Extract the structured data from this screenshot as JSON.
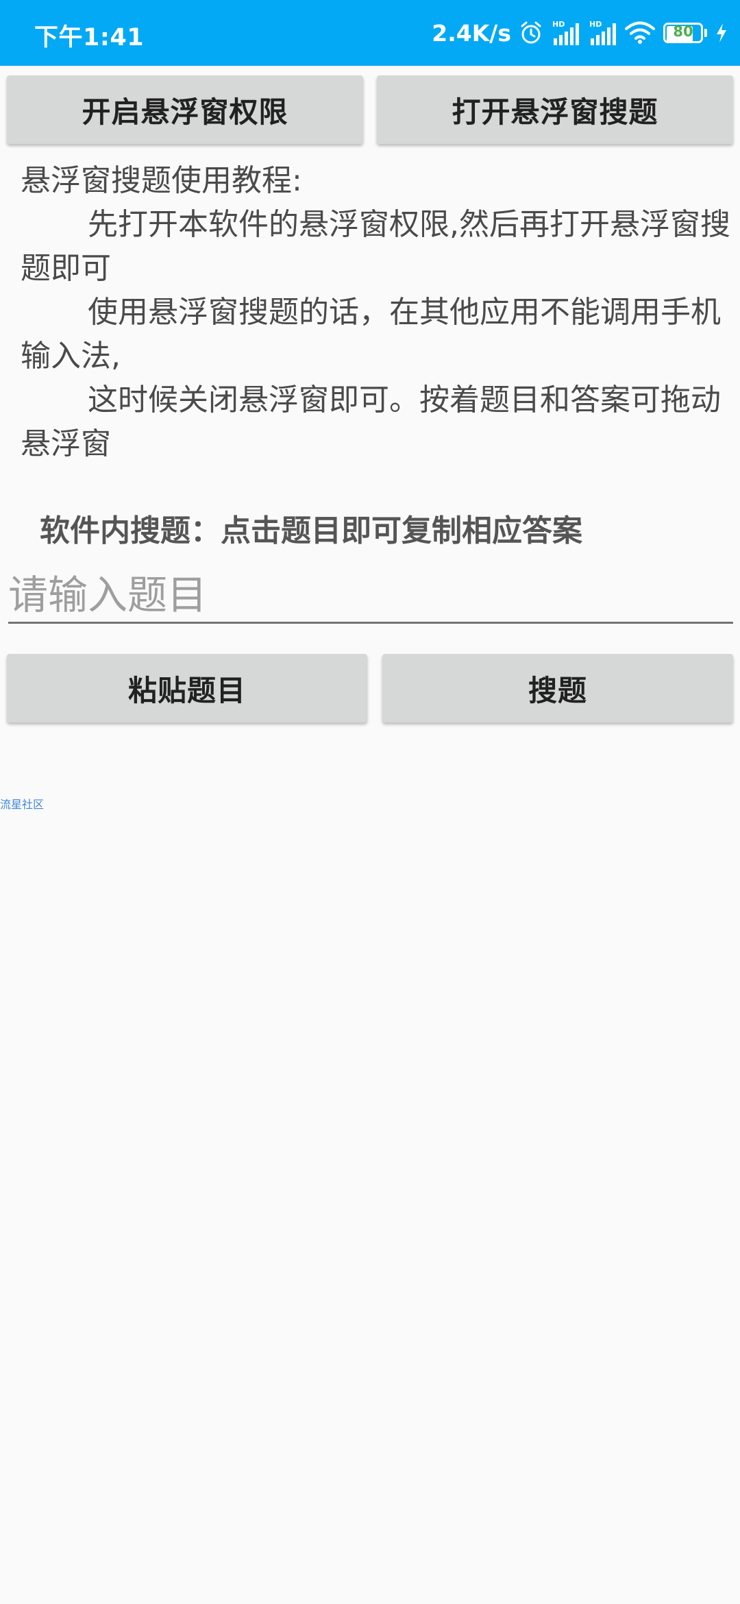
{
  "status_bar": {
    "time": "下午1:41",
    "net_speed": "2.4K/s",
    "battery_level": "80",
    "battery_fraction": 0.8,
    "icons": [
      "alarm-icon",
      "hd-signal-icon",
      "hd-signal-icon",
      "wifi-icon",
      "battery-icon",
      "charging-icon"
    ]
  },
  "buttons": {
    "permission": "开启悬浮窗权限",
    "open_float": "打开悬浮窗搜题",
    "paste": "粘贴题目",
    "search": "搜题"
  },
  "tutorial": {
    "title": "悬浮窗搜题使用教程:",
    "step1": "先打开本软件的悬浮窗权限,然后再打开悬浮窗搜题即可",
    "step2": "使用悬浮窗搜题的话，在其他应用不能调用手机输入法,",
    "step3": "这时候关闭悬浮窗即可。按着题目和答案可拖动悬浮窗"
  },
  "search_note": "软件内搜题：点击题目即可复制相应答案",
  "input": {
    "placeholder": "请输入题目",
    "value": ""
  },
  "community_link": "流星社区",
  "colors": {
    "status_bar": "#03a9f4",
    "button_bg": "#d6d7d7",
    "background": "#fafafa",
    "battery_text": "#4caf50",
    "link": "#3f86d6"
  }
}
